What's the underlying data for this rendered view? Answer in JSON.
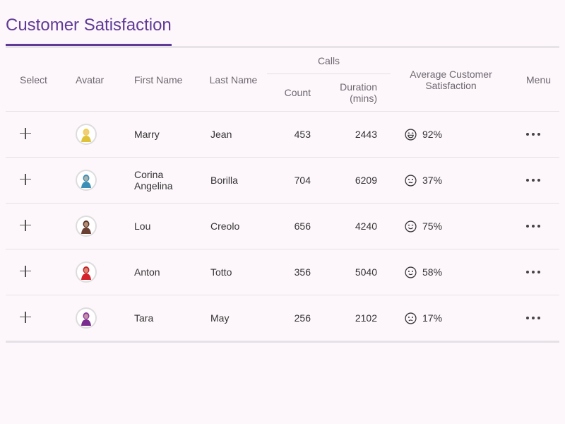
{
  "title": "Customer Satisfaction",
  "headers": {
    "select": "Select",
    "avatar": "Avatar",
    "first_name": "First Name",
    "last_name": "Last Name",
    "calls": "Calls",
    "count": "Count",
    "duration": "Duration (mins)",
    "satisfaction": "Average Customer Satisfaction",
    "menu": "Menu"
  },
  "rows": [
    {
      "first_name": "Marry",
      "last_name": "Jean",
      "count": "453",
      "duration": "2443",
      "satisfaction": "92%",
      "face": "laughing-face-icon",
      "avatar_colors": {
        "body": "#e0c23a",
        "head": "#f0d04a"
      }
    },
    {
      "first_name": "Corina Angelina",
      "last_name": "Borilla",
      "count": "704",
      "duration": "6209",
      "satisfaction": "37%",
      "face": "confused-face-icon",
      "avatar_colors": {
        "body": "#3b8fb6",
        "head": "#3b8fb6"
      }
    },
    {
      "first_name": "Lou",
      "last_name": "Creolo",
      "count": "656",
      "duration": "4240",
      "satisfaction": "75%",
      "face": "smiling-face-icon",
      "avatar_colors": {
        "body": "#6b3f32",
        "head": "#5a3428"
      }
    },
    {
      "first_name": "Anton",
      "last_name": "Totto",
      "count": "356",
      "duration": "5040",
      "satisfaction": "58%",
      "face": "slight-smile-face-icon",
      "avatar_colors": {
        "body": "#d4232a",
        "head": "#c41e25"
      }
    },
    {
      "first_name": "Tara",
      "last_name": "May",
      "count": "256",
      "duration": "2102",
      "satisfaction": "17%",
      "face": "sad-face-icon",
      "avatar_colors": {
        "body": "#7b2c8f",
        "head": "#8a3aa0"
      }
    }
  ]
}
